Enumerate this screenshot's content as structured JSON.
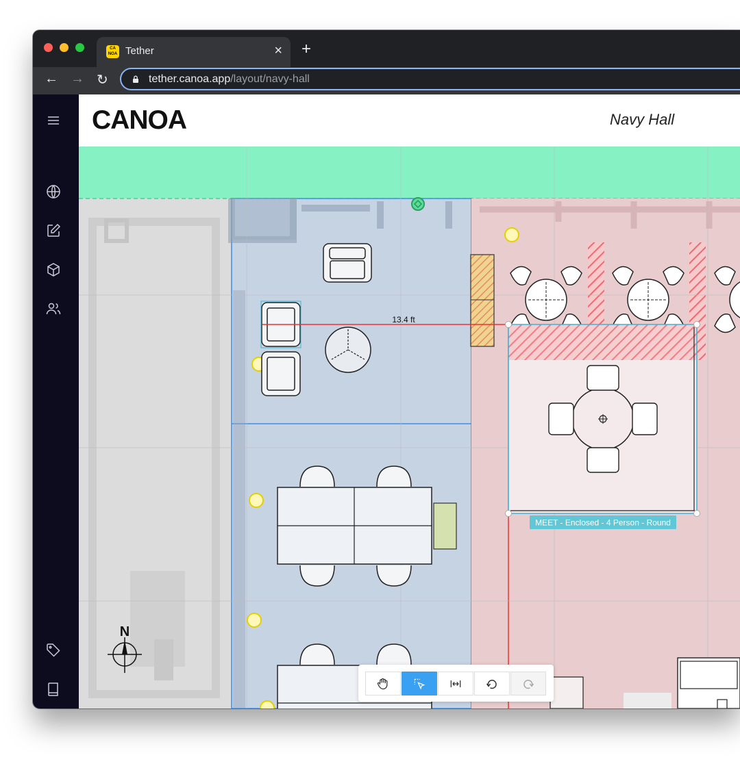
{
  "browser": {
    "tab_title": "Tether",
    "favicon_text": "CA\nNOA",
    "close_glyph": "×",
    "new_tab_glyph": "+",
    "back_glyph": "←",
    "forward_glyph": "→",
    "reload_glyph": "↻",
    "url_host": "tether.canoa.app",
    "url_path": "/layout/navy-hall"
  },
  "sidebar": {
    "items": [
      "menu-icon",
      "globe-icon",
      "edit-icon",
      "box-icon",
      "users-icon",
      "tag-icon",
      "book-icon"
    ]
  },
  "header": {
    "logo": "CANOA",
    "venue_name": "Navy Hall"
  },
  "plan": {
    "dimension_label": "13.4 ft",
    "selected_label": "MEET - Enclosed - 4 Person - Round",
    "compass_label": "N"
  },
  "tools": [
    "pan-hand-icon",
    "select-cursor-icon",
    "measure-icon",
    "undo-icon",
    "redo-icon"
  ],
  "colors": {
    "accent_blue": "#3aa0f2",
    "zone_green": "#86f2c4",
    "zone_blue": "#c6d3e3",
    "zone_red": "#e9cccd",
    "label_teal": "#61c7d6"
  }
}
